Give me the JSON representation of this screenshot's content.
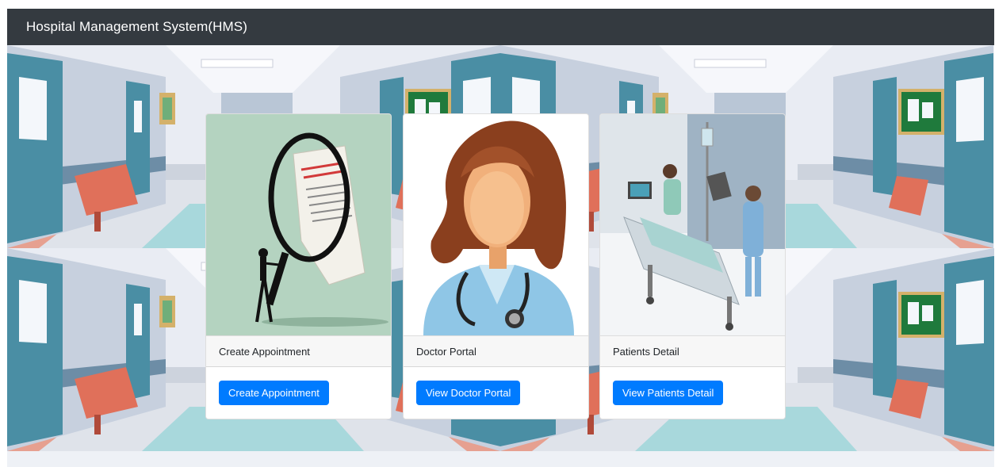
{
  "navbar": {
    "title": "Hospital Management System(HMS)"
  },
  "cards": [
    {
      "header": "Create Appointment",
      "button": "Create Appointment",
      "image": "appointment-magnifier-illustration"
    },
    {
      "header": "Doctor Portal",
      "button": "View Doctor Portal",
      "image": "doctor-avatar-illustration"
    },
    {
      "header": "Patients Detail",
      "button": "View Patients Detail",
      "image": "patient-bed-illustration"
    }
  ],
  "colors": {
    "navbar_bg": "#343a40",
    "button_primary": "#007bff",
    "card_header_bg": "#f7f7f7",
    "door_teal": "#4a8ea4",
    "bench_orange": "#e0705a",
    "board_green": "#1f7a3c"
  }
}
